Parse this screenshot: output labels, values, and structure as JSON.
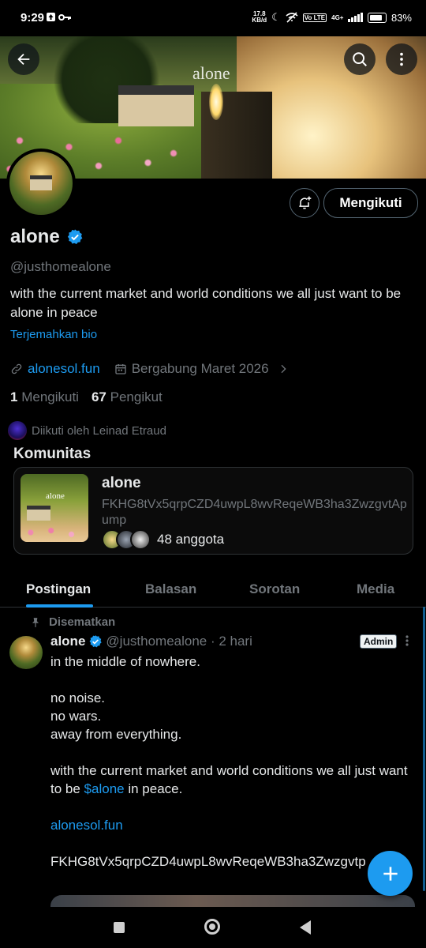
{
  "status_bar": {
    "time": "9:29",
    "net_speed_value": "17.8",
    "net_speed_unit": "KB/d",
    "network": "4G+",
    "volte": "Vo LTE",
    "battery": "83%"
  },
  "banner": {
    "watermark": "alone"
  },
  "header": {
    "back_icon": "arrow-left-icon",
    "search_icon": "search-icon",
    "more_icon": "more-vertical-icon"
  },
  "profile": {
    "follow_button": "Mengikuti",
    "name": "alone",
    "handle": "@justhomealone",
    "bio": "with the current market and world conditions we all just want to be alone in peace",
    "translate_bio": "Terjemahkan bio",
    "website": "alonesol.fun",
    "joined": "Bergabung Maret 2026",
    "following_count": "1",
    "following_label": "Mengikuti",
    "followers_count": "67",
    "followers_label": "Pengikut",
    "followed_by": "Diikuti oleh Leinad Etraud"
  },
  "community": {
    "section_title": "Komunitas",
    "name": "alone",
    "subtitle": "FKHG8tVx5qrpCZD4uwpL8wvReqeWB3ha3ZwzgvtApump",
    "thumb_watermark": "alone",
    "members": "48 anggota"
  },
  "tabs": [
    "Postingan",
    "Balasan",
    "Sorotan",
    "Media"
  ],
  "post": {
    "pinned_label": "Disematkan",
    "author": "alone",
    "handle_time": "@justhomealone · 2 hari",
    "badge": "Admin",
    "line1": "in the middle of nowhere.",
    "line2": "no noise.",
    "line3": "no wars.",
    "line4": "away from everything.",
    "line5_pre": "with the current market and world conditions we all just want to be ",
    "line5_link": "$alone",
    "line5_post": " in peace.",
    "link": "alonesol.fun",
    "contract": "FKHG8tVx5qrpCZD4uwpL8wvReqeWB3ha3Zwzgvtp"
  },
  "fab_icon": "plus-icon",
  "colors": {
    "accent": "#1d9bf0",
    "background": "#000000",
    "muted": "#71767b",
    "text": "#e7e9ea"
  }
}
